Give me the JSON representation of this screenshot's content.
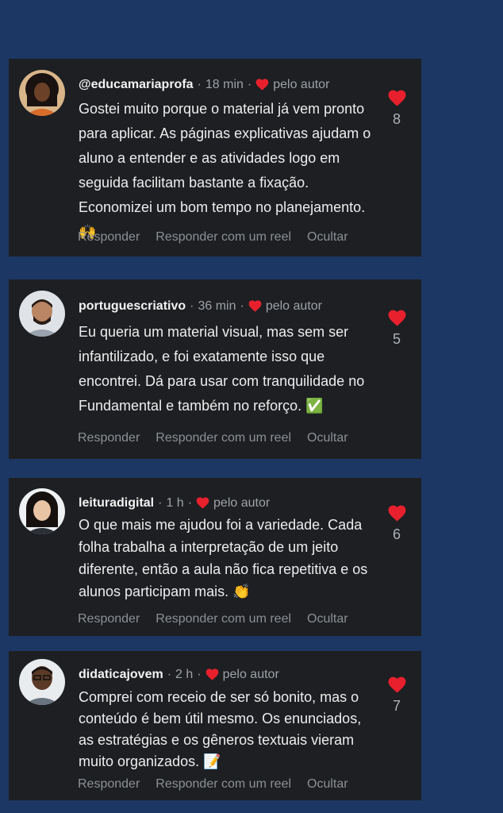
{
  "colors": {
    "background": "#1c3763",
    "card": "#1d1f22",
    "heart": "#e8202e",
    "text": "#ededed",
    "muted": "#9ea2a6"
  },
  "comments": [
    {
      "username": "@educamariaprofa",
      "time": "18 min",
      "author_label": "pelo autor",
      "text": "Gostei muito porque o material já vem pronto para aplicar. As páginas explicativas ajudam o aluno a entender e as atividades logo em seguida facilitam bastante a fixação. Economizei um bom tempo no planejamento. 🙌",
      "likes": "8",
      "actions": [
        "Responder",
        "Responder com um reel",
        "Ocultar"
      ]
    },
    {
      "username": "portuguescriativo",
      "time": "36 min",
      "author_label": "pelo autor",
      "text": "Eu queria um material visual, mas sem ser infantilizado, e foi exatamente isso que encontrei. Dá para usar com tranquilidade no Fundamental e também no reforço. ✅",
      "likes": "5",
      "actions": [
        "Responder",
        "Responder com um reel",
        "Ocultar"
      ]
    },
    {
      "username": "leituradigital",
      "time": "1 h",
      "author_label": "pelo autor",
      "text": "O que mais me ajudou foi a variedade. Cada folha trabalha a interpretação de um jeito diferente, então a aula não fica repetitiva e os alunos participam mais. 👏",
      "likes": "6",
      "actions": [
        "Responder",
        "Responder com um reel",
        "Ocultar"
      ]
    },
    {
      "username": "didaticajovem",
      "time": "2 h",
      "author_label": "pelo autor",
      "text": "Comprei com receio de ser só bonito, mas o conteúdo é bem útil mesmo. Os enunciados, as estratégias e os gêneros textuais vieram muito organizados. 📝",
      "likes": "7",
      "actions": [
        "Responder",
        "Responder com um reel",
        "Ocultar"
      ]
    }
  ]
}
